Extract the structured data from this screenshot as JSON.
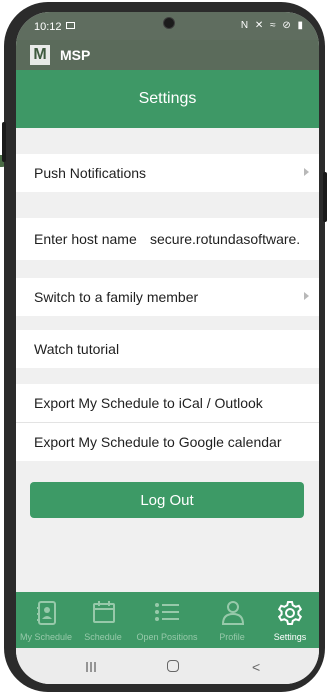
{
  "status": {
    "time": "10:12",
    "icons": "N ✕ ≈ ⊘ ▮"
  },
  "app": {
    "logo": "M",
    "name": "MSP"
  },
  "page": {
    "title": "Settings"
  },
  "settings": {
    "push_notifications": "Push Notifications",
    "host_label": "Enter host name",
    "host_value": "secure.rotundasoftware.",
    "switch_family": "Switch to a family member",
    "watch_tutorial": "Watch tutorial",
    "export_ical": "Export My Schedule to iCal / Outlook",
    "export_google": "Export My Schedule to Google calendar"
  },
  "logout_label": "Log Out",
  "tabs": [
    {
      "label": "My Schedule",
      "icon": "contact-book-icon"
    },
    {
      "label": "Schedule",
      "icon": "calendar-icon"
    },
    {
      "label": "Open Positions",
      "icon": "list-icon"
    },
    {
      "label": "Profile",
      "icon": "person-icon"
    },
    {
      "label": "Settings",
      "icon": "gear-icon",
      "active": true
    }
  ],
  "colors": {
    "primary": "#3e9866",
    "header": "#5b6b5b",
    "background": "#f0f0f0"
  }
}
